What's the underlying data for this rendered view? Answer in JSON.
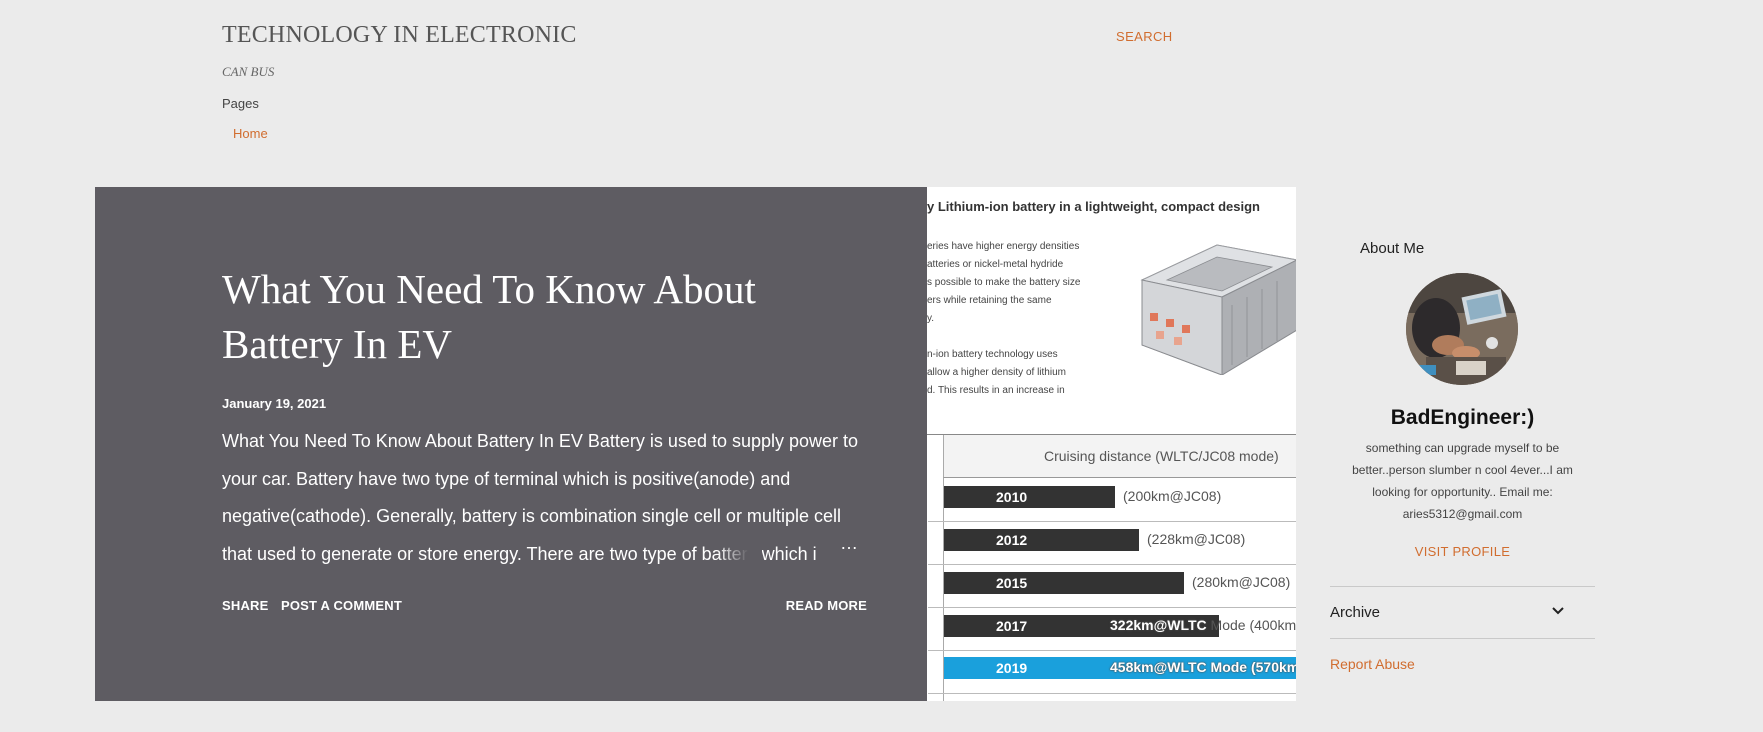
{
  "header": {
    "site_title": "TECHNOLOGY IN ELECTRONIC",
    "site_description": "CAN BUS",
    "pages_label": "Pages",
    "nav_items": [
      {
        "label": "Home"
      }
    ],
    "search_label": "SEARCH"
  },
  "post": {
    "title": "What You Need To Know About Battery In EV",
    "date": "January 19, 2021",
    "snippet": "What You Need To Know About Battery In EV Battery is used to supply power to your car. Battery have two type of terminal which is positive(anode) and negative(cathode). Generally, battery is combination single cell or multiple cell that used to generate or store energy. There are two type of battery which i",
    "ellipsis": "…",
    "share_label": "SHARE",
    "comment_label": "POST A COMMENT",
    "read_more_label": "READ MORE",
    "image": {
      "headline": "y Lithium-ion battery in a lightweight, compact design",
      "lines": [
        "eries have higher energy densities",
        "atteries or nickel-metal hydride",
        "s possible to make the battery size",
        "ers while retaining the same",
        "y.",
        "n-ion battery technology uses",
        "allow a higher density of lithium",
        "d. This results in an increase in"
      ],
      "chart_header": "Cruising distance (WLTC/JC08 mode)",
      "rows": [
        {
          "year": "2010",
          "note": "(200km@JC08)"
        },
        {
          "year": "2012",
          "note": "(228km@JC08)"
        },
        {
          "year": "2015",
          "note": "(280km@JC08)"
        },
        {
          "year": "2017",
          "note_a": "322km@WLTC",
          "note_b": " Mode (400km"
        },
        {
          "year": "2019",
          "note_a": "458km@WLTC",
          "note_b": " Mode (570km"
        }
      ],
      "highlight_color": "#1aa0dc"
    }
  },
  "sidebar": {
    "about_title": "About Me",
    "profile_name": "BadEngineer:)",
    "profile_description": "something can upgrade myself to be better..person slumber n cool 4ever...I am looking for opportunity.. Email me: aries5312@gmail.com",
    "visit_profile_label": "VISIT PROFILE",
    "archive_label": "Archive",
    "report_abuse_label": "Report Abuse"
  },
  "colors": {
    "background": "#ebebeb",
    "card": "#5e5c62",
    "accent": "#d16d2f"
  },
  "icons": {
    "archive_toggle": "chevron-down-icon"
  }
}
